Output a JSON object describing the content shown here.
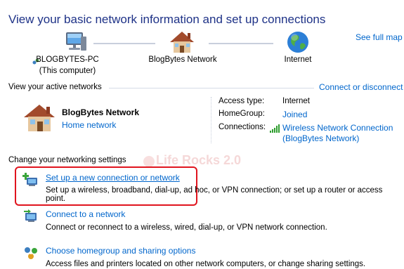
{
  "title": "View your basic network information and set up connections",
  "see_full_map": "See full map",
  "map": {
    "computer": {
      "name": "BLOGBYTES-PC",
      "sub": "(This computer)"
    },
    "network": {
      "name": "BlogBytes Network"
    },
    "internet": {
      "name": "Internet"
    }
  },
  "active_networks": {
    "heading": "View your active networks",
    "action": "Connect or disconnect",
    "network_name": "BlogBytes Network",
    "network_type": "Home network",
    "details": {
      "access_type_label": "Access type:",
      "access_type_value": "Internet",
      "homegroup_label": "HomeGroup:",
      "homegroup_value": "Joined",
      "connections_label": "Connections:",
      "connections_value_line1": "Wireless Network Connection",
      "connections_value_line2": "(BlogBytes Network)"
    }
  },
  "settings": {
    "heading": "Change your networking settings",
    "tasks": [
      {
        "title": "Set up a new connection or network",
        "desc": "Set up a wireless, broadband, dial-up, ad hoc, or VPN connection; or set up a router or access point.",
        "icon": "new-connection-icon"
      },
      {
        "title": "Connect to a network",
        "desc": "Connect or reconnect to a wireless, wired, dial-up, or VPN network connection.",
        "icon": "connect-network-icon"
      },
      {
        "title": "Choose homegroup and sharing options",
        "desc": "Access files and printers located on other network computers, or change sharing settings.",
        "icon": "homegroup-icon"
      }
    ]
  },
  "watermark": "Life Rocks 2.0",
  "colors": {
    "title": "#1e3287",
    "link": "#0066cc",
    "highlight": "#e0141e"
  }
}
